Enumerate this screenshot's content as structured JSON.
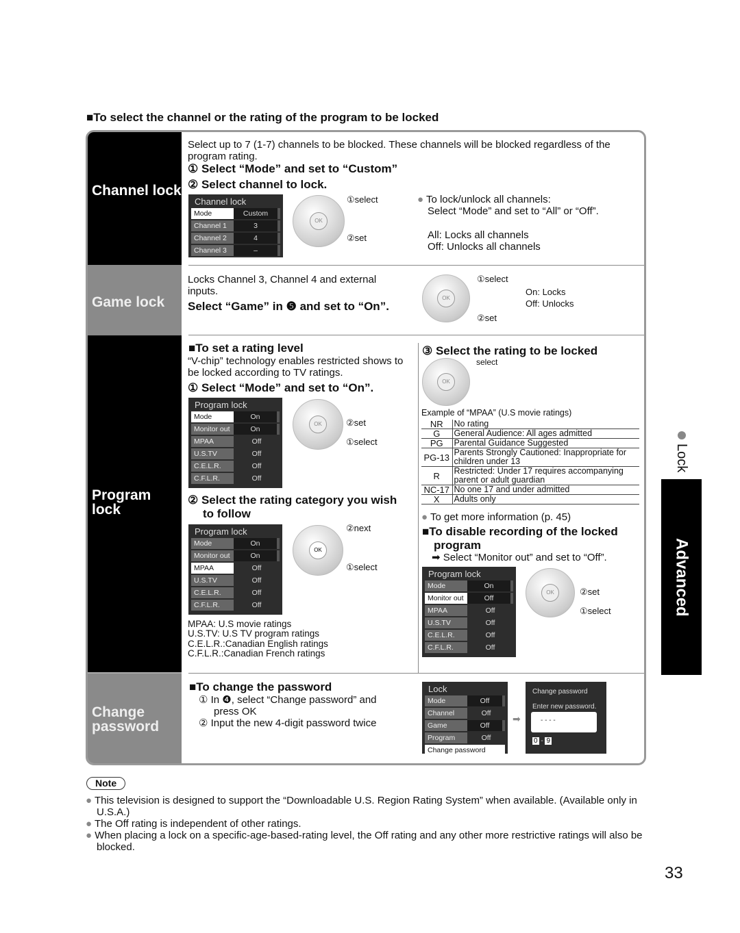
{
  "heading": "■To select the channel or the rating of the program to be locked",
  "sections": {
    "channel": "Channel lock",
    "game": "Game lock",
    "program": "Program lock",
    "password": "Change password"
  },
  "channel": {
    "intro": "Select up to 7 (1-7) channels to be blocked. These channels will be blocked regardless of the program rating.",
    "step1": "① Select “Mode” and set to “Custom”",
    "step2": "② Select channel to lock.",
    "dial_select": "①select",
    "dial_set": "②set",
    "note1": "To lock/unlock all channels:",
    "note2": "Select “Mode” and set to “All” or “Off”.",
    "all": "All:  Locks all channels",
    "off": "Off: Unlocks all channels"
  },
  "game": {
    "intro": "Locks Channel 3, Channel 4 and external inputs.",
    "step": "Select “Game” in ❺ and set to “On”.",
    "dial_select": "①select",
    "dial_set": "②set",
    "on": "On:  Locks",
    "off": "Off:  Unlocks"
  },
  "program": {
    "rating_heading": "■To set a rating level",
    "rating_intro": "“V-chip” technology enables restricted shows to be locked according to TV ratings.",
    "step1": "① Select “Mode” and set to “On”.",
    "dial1_set": "②set",
    "dial1_select": "①select",
    "step2a": "② Select the rating category you wish",
    "step2b": "to follow",
    "dial2_next": "②next",
    "dial2_select": "①select",
    "legend": [
      "MPAA:   U.S movie ratings",
      "U.S.TV:  U.S TV program ratings",
      "C.E.L.R.:Canadian English ratings",
      "C.F.L.R.:Canadian French ratings"
    ],
    "step3": "③ Select the rating to be locked",
    "dial3_select": "select",
    "example": "Example of “MPAA” (U.S movie ratings)",
    "ratings": [
      {
        "code": "NR",
        "desc": "No rating"
      },
      {
        "code": "G",
        "desc": "General Audience:  All ages admitted"
      },
      {
        "code": "PG",
        "desc": "Parental Guidance Suggested"
      },
      {
        "code": "PG-13",
        "desc": "Parents Strongly Cautioned:  Inappropriate for children under 13"
      },
      {
        "code": "R",
        "desc": "Restricted:  Under 17 requires accompanying parent or adult guardian"
      },
      {
        "code": "NC-17",
        "desc": "No one 17 and under admitted"
      },
      {
        "code": "X",
        "desc": "Adults only"
      }
    ],
    "more_info": "To get more information (p. 45)",
    "disable_heading1": "■To disable recording of the locked",
    "disable_heading2": "program",
    "disable_step": "➡ Select “Monitor out” and set to “Off”.",
    "dial4_set": "②set",
    "dial4_select": "①select"
  },
  "password": {
    "heading": "■To change the password",
    "step1a": "① In ❹, select “Change password” and",
    "step1b": "press OK",
    "step2": "② Input the new 4-digit password twice",
    "arrow": "➡",
    "dlg_title": "Change password",
    "dlg_prompt": "Enter new password.",
    "dlg_value": "- - - -",
    "key0": "0",
    "dash": "-",
    "key9": "9"
  },
  "menus": [
    {
      "id": "m-channel",
      "title": "Channel lock",
      "rows": [
        [
          "Mode",
          "Custom",
          "hl box"
        ],
        [
          "Channel 1",
          "3",
          "box"
        ],
        [
          "Channel 2",
          "4",
          "box"
        ],
        [
          "Channel 3",
          "–",
          "box"
        ]
      ]
    },
    {
      "id": "m-prog1",
      "title": "Program lock",
      "rows": [
        [
          "Mode",
          "On",
          "hl box"
        ],
        [
          "Monitor out",
          "On",
          "box"
        ],
        [
          "MPAA",
          "Off",
          ""
        ],
        [
          "U.S.TV",
          "Off",
          ""
        ],
        [
          "C.E.L.R.",
          "Off",
          ""
        ],
        [
          "C.F.L.R.",
          "Off",
          ""
        ]
      ]
    },
    {
      "id": "m-prog2",
      "title": "Program lock",
      "rows": [
        [
          "Mode",
          "On",
          "box"
        ],
        [
          "Monitor out",
          "On",
          "box"
        ],
        [
          "MPAA",
          "Off",
          "hl"
        ],
        [
          "U.S.TV",
          "Off",
          ""
        ],
        [
          "C.E.L.R.",
          "Off",
          ""
        ],
        [
          "C.F.L.R.",
          "Off",
          ""
        ]
      ]
    },
    {
      "id": "m-prog3",
      "title": "Program lock",
      "rows": [
        [
          "Mode",
          "On",
          "box"
        ],
        [
          "Monitor out",
          "Off",
          "hl box"
        ],
        [
          "MPAA",
          "Off",
          ""
        ],
        [
          "U.S.TV",
          "Off",
          ""
        ],
        [
          "C.E.L.R.",
          "Off",
          ""
        ],
        [
          "C.F.L.R.",
          "Off",
          ""
        ]
      ]
    },
    {
      "id": "m-lock",
      "title": "Lock",
      "rows": [
        [
          "Mode",
          "Off",
          "box"
        ],
        [
          "Channel",
          "Off",
          ""
        ],
        [
          "Game",
          "Off",
          "box"
        ],
        [
          "Program",
          "Off",
          ""
        ],
        [
          "Change password",
          "",
          "full"
        ]
      ]
    }
  ],
  "dial_ok": "OK",
  "side_tab": {
    "bullet": "Lock",
    "tab": "Advanced"
  },
  "note": {
    "label": "Note",
    "items": [
      "This television is designed to support the  “Downloadable U.S. Region Rating System” when available.  (Available only in U.S.A.)",
      "The Off rating is independent of other ratings.",
      "When placing a lock on a specific-age-based-rating level, the Off rating and any other more restrictive ratings will also be blocked."
    ]
  },
  "page_number": "33"
}
